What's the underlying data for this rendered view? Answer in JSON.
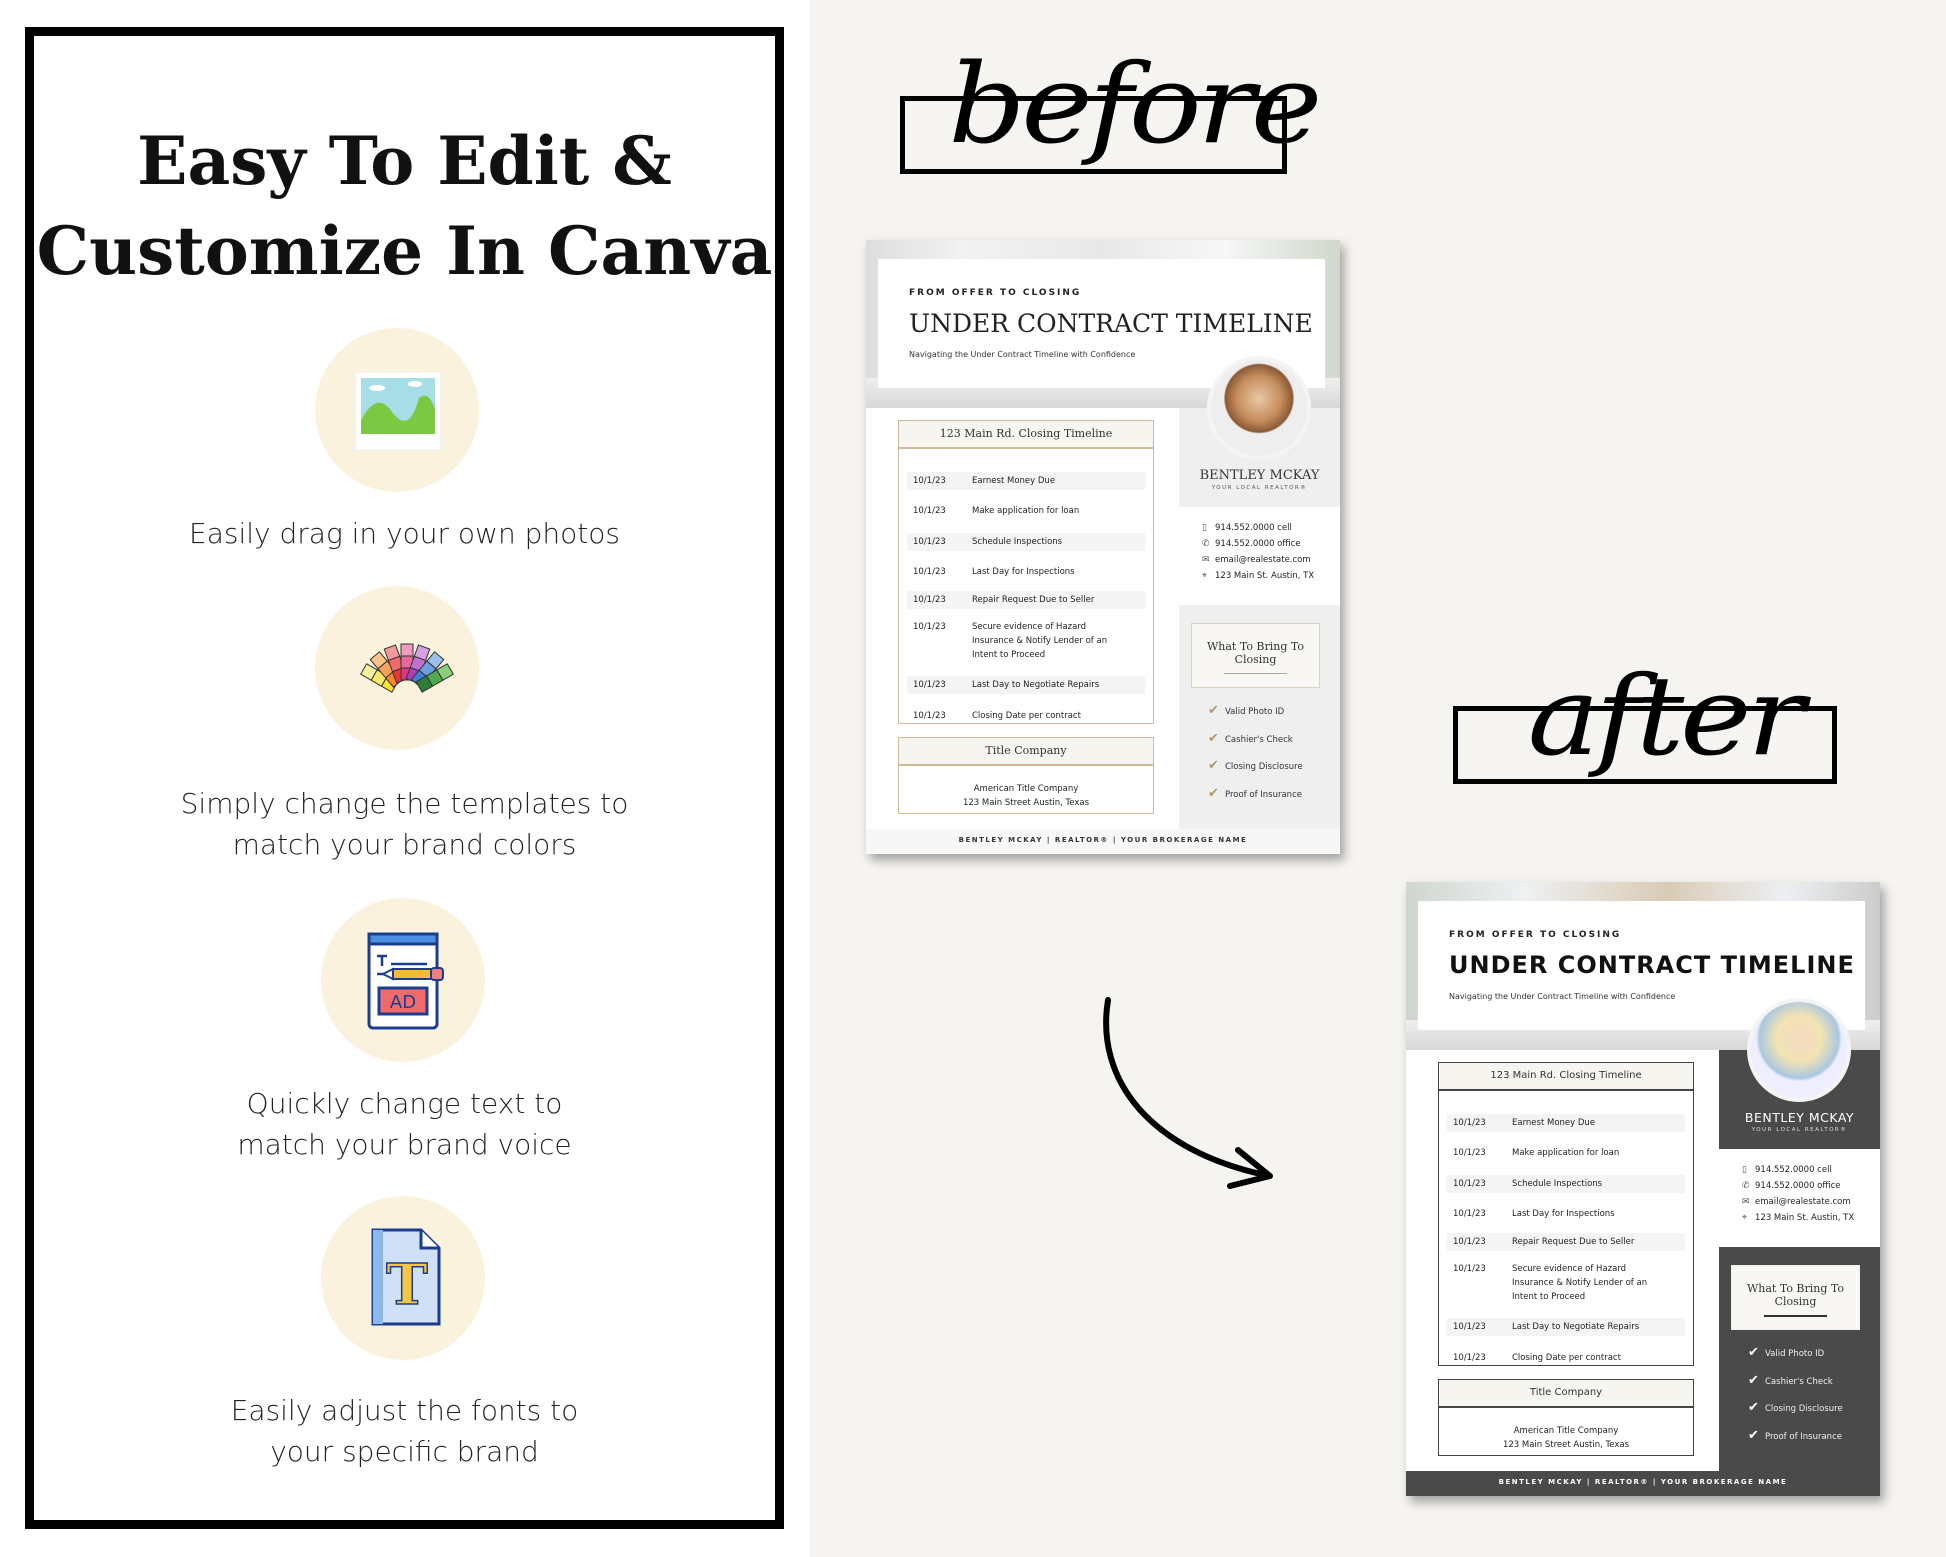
{
  "left_panel": {
    "headline": [
      "Easy To Edit &",
      "Customize In Canva"
    ],
    "features": [
      {
        "icon": "photo-icon",
        "lines": [
          "Easily drag in your own photos"
        ]
      },
      {
        "icon": "color-swatch-fan-icon",
        "lines": [
          "Simply change the templates to",
          "match your brand colors"
        ]
      },
      {
        "icon": "edit-text-document-icon",
        "lines": [
          "Quickly change text to",
          "match your brand voice"
        ],
        "icon_text": "AD"
      },
      {
        "icon": "font-file-icon",
        "lines": [
          "Easily adjust the fonts to",
          "your specific brand"
        ],
        "icon_text": "T"
      }
    ]
  },
  "labels": {
    "before": "before",
    "after": "after"
  },
  "flyers": {
    "before": {
      "eyebrow": "FROM OFFER TO CLOSING",
      "title": "UNDER CONTRACT TIMELINE",
      "subtitle": "Navigating the Under Contract Timeline with Confidence",
      "timeline_title": "123 Main Rd. Closing Timeline",
      "rows": [
        {
          "date": "10/1/23",
          "task": "Earnest Money Due"
        },
        {
          "date": "10/1/23",
          "task": "Make application for loan"
        },
        {
          "date": "10/1/23",
          "task": "Schedule Inspections"
        },
        {
          "date": "10/1/23",
          "task": "Last Day for Inspections"
        },
        {
          "date": "10/1/23",
          "task": "Repair Request Due to Seller"
        },
        {
          "date": "10/1/23",
          "task": "Secure evidence of Hazard Insurance & Notify Lender of an Intent to Proceed"
        },
        {
          "date": "10/1/23",
          "task": "Last Day to Negotiate Repairs"
        },
        {
          "date": "10/1/23",
          "task": "Closing Date per contract"
        }
      ],
      "title_company_header": "Title Company",
      "title_company_name": "American Title Company",
      "title_company_address": "123 Main Street Austin, Texas",
      "agent_name": "BENTLEY MCKAY",
      "agent_role": "YOUR LOCAL REALTOR®",
      "contacts": [
        {
          "icon": "mobile-phone-icon",
          "text": "914.552.0000 cell"
        },
        {
          "icon": "phone-icon",
          "text": "914.552.0000 office"
        },
        {
          "icon": "envelope-icon",
          "text": "email@realestate.com"
        },
        {
          "icon": "map-pin-icon",
          "text": "123 Main St. Austin, TX"
        }
      ],
      "bring_title": "What To Bring To Closing",
      "checklist": [
        "Valid Photo ID",
        "Cashier's Check",
        "Closing Disclosure",
        "Proof of Insurance"
      ],
      "footer": "BENTLEY MCKAY |  REALTOR®  |  YOUR BROKERAGE NAME",
      "accent": "#cdbb98"
    },
    "after": {
      "eyebrow": "FROM OFFER TO CLOSING",
      "title": "UNDER CONTRACT TIMELINE",
      "subtitle": "Navigating the Under Contract Timeline with Confidence",
      "timeline_title": "123 Main Rd. Closing Timeline",
      "rows": [
        {
          "date": "10/1/23",
          "task": "Earnest Money Due"
        },
        {
          "date": "10/1/23",
          "task": "Make application for loan"
        },
        {
          "date": "10/1/23",
          "task": "Schedule Inspections"
        },
        {
          "date": "10/1/23",
          "task": "Last Day for Inspections"
        },
        {
          "date": "10/1/23",
          "task": "Repair Request Due to Seller"
        },
        {
          "date": "10/1/23",
          "task": "Secure evidence of Hazard Insurance & Notify Lender of an Intent to Proceed"
        },
        {
          "date": "10/1/23",
          "task": "Last Day to Negotiate Repairs"
        },
        {
          "date": "10/1/23",
          "task": "Closing Date per contract"
        }
      ],
      "title_company_header": "Title Company",
      "title_company_name": "American Title Company",
      "title_company_address": "123 Main Street Austin, Texas",
      "agent_name": "BENTLEY MCKAY",
      "agent_role": "YOUR LOCAL REALTOR®",
      "contacts": [
        {
          "icon": "mobile-phone-icon",
          "text": "914.552.0000 cell"
        },
        {
          "icon": "phone-icon",
          "text": "914.552.0000 office"
        },
        {
          "icon": "envelope-icon",
          "text": "email@realestate.com"
        },
        {
          "icon": "map-pin-icon",
          "text": "123 Main St. Austin, TX"
        }
      ],
      "bring_title": "What To Bring To Closing",
      "checklist": [
        "Valid Photo ID",
        "Cashier's Check",
        "Closing Disclosure",
        "Proof of Insurance"
      ],
      "footer": "BENTLEY MCKAY |  REALTOR®  |  YOUR BROKERAGE NAME",
      "accent": "#4a4a4a"
    }
  }
}
